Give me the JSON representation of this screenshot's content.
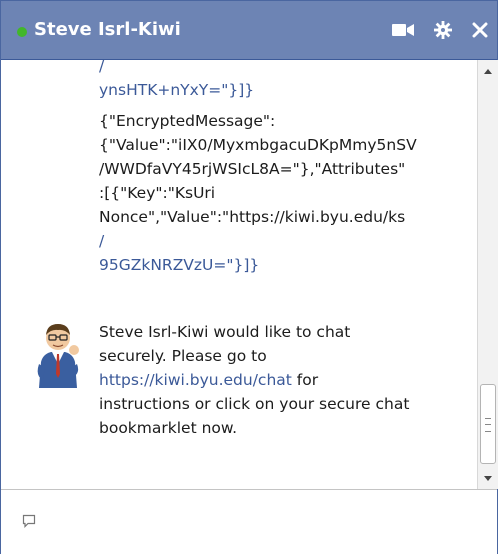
{
  "window": {
    "title": "Steve Isrl-Kiwi",
    "presence": "online",
    "colors": {
      "titlebar": "#6d84b4",
      "presence": "#42b72a",
      "link": "#3b5998"
    }
  },
  "toolbar": {
    "video_icon": "video-camera-icon",
    "settings_icon": "gear-icon",
    "close_icon": "close-icon"
  },
  "messages": [
    {
      "lines": [
        "/",
        "ynsHTK+nYxY=\"}]}"
      ]
    },
    {
      "lines": [
        "{\"EncryptedMessage\":",
        "{\"Value\":\"iIX0/MyxmbgacuDKpMmy5nSV",
        "/WWDfaVY45rjWSIcL8A=\"},\"Attributes\"",
        ":[{\"Key\":\"KsUri",
        "Nonce\",\"Value\":\"https://kiwi.byu.edu/ks",
        "/",
        "95GZkNRZVzU=\"}]}"
      ]
    },
    {
      "sender_avatar": "avatar",
      "line1": "Steve Isrl-Kiwi would like to chat",
      "line2": "securely. Please go to",
      "link": "https://kiwi.byu.edu/chat",
      "line3_after": " for",
      "line4": "instructions or click on your secure chat",
      "line5": "bookmarklet now."
    }
  ],
  "compose": {
    "placeholder": ""
  }
}
